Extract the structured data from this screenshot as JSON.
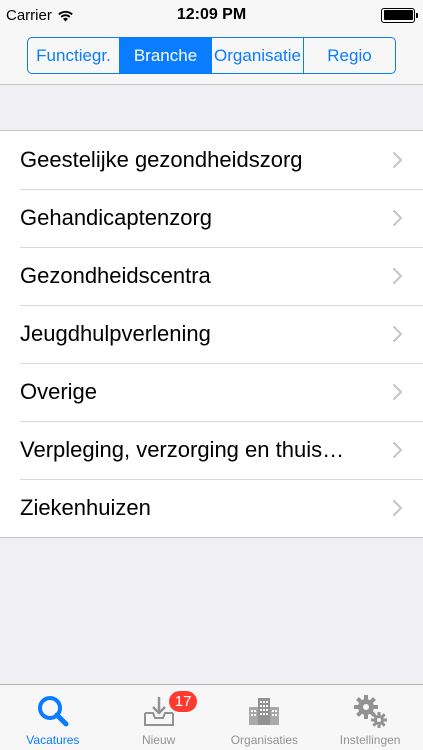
{
  "status_bar": {
    "carrier": "Carrier",
    "time": "12:09 PM"
  },
  "segmented_control": {
    "segments": [
      {
        "label": "Functiegr.",
        "active": false
      },
      {
        "label": "Branche",
        "active": true
      },
      {
        "label": "Organisatie",
        "active": false
      },
      {
        "label": "Regio",
        "active": false
      }
    ]
  },
  "list": {
    "items": [
      {
        "label": "Geestelijke gezondheidszorg"
      },
      {
        "label": "Gehandicaptenzorg"
      },
      {
        "label": "Gezondheidscentra"
      },
      {
        "label": "Jeugdhulpverlening"
      },
      {
        "label": "Overige"
      },
      {
        "label": "Verpleging, verzorging en thuis…"
      },
      {
        "label": "Ziekenhuizen"
      }
    ]
  },
  "tab_bar": {
    "tabs": [
      {
        "label": "Vacatures",
        "icon": "search-icon",
        "active": true
      },
      {
        "label": "Nieuw",
        "icon": "inbox-download-icon",
        "badge": "17",
        "active": false
      },
      {
        "label": "Organisaties",
        "icon": "buildings-icon",
        "active": false
      },
      {
        "label": "Instellingen",
        "icon": "gears-icon",
        "active": false
      }
    ]
  },
  "colors": {
    "accent": "#0a7cff",
    "badge": "#ff3b30",
    "inactive": "#929292"
  }
}
